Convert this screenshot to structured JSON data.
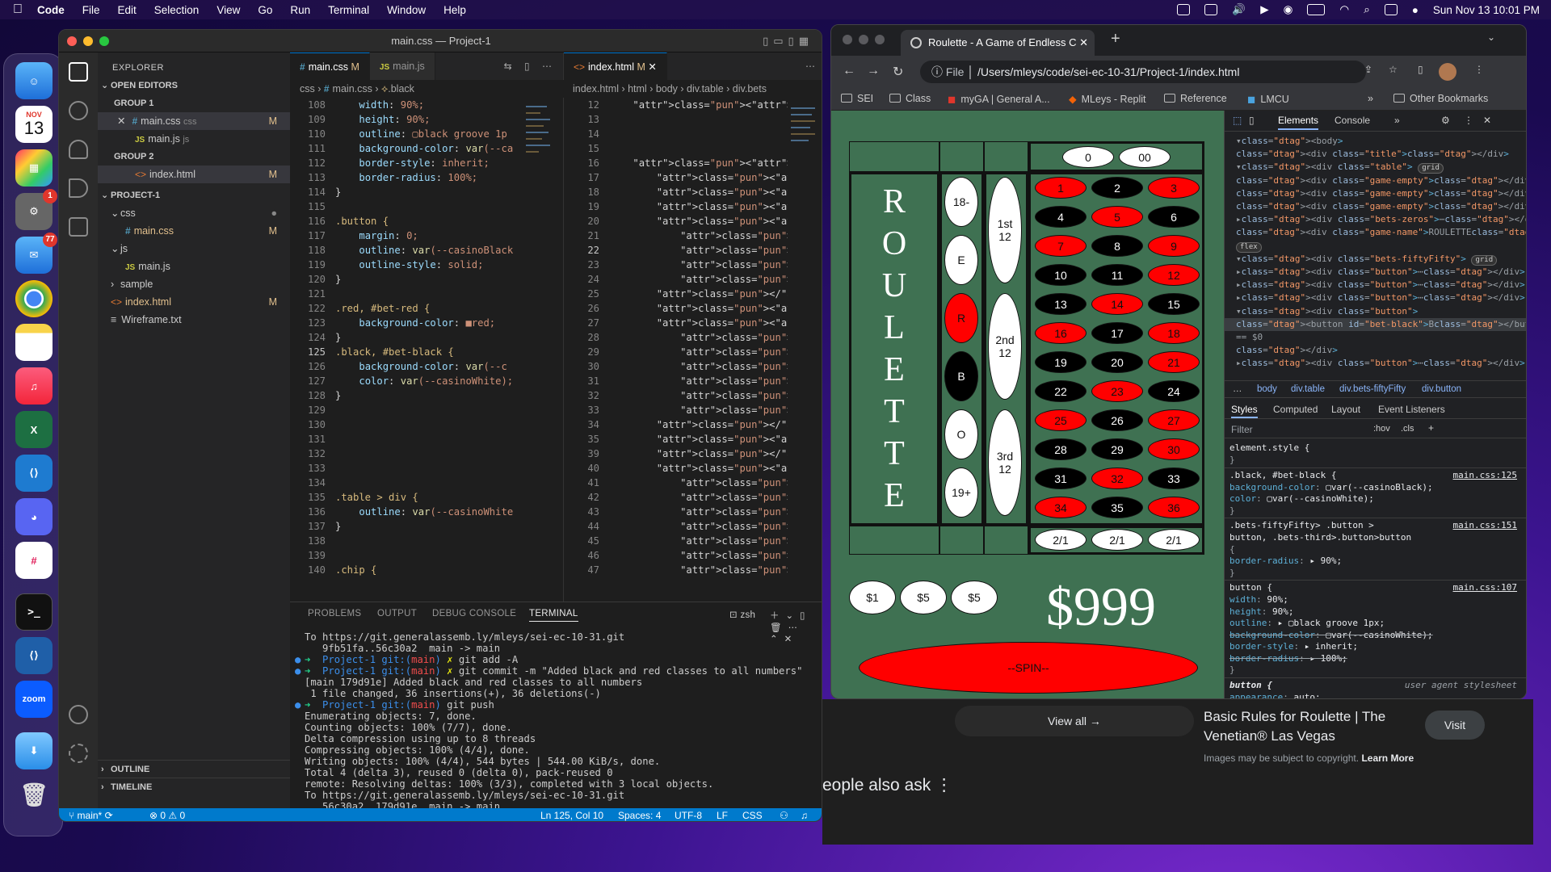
{
  "menubar": {
    "app": "Code",
    "items": [
      "File",
      "Edit",
      "Selection",
      "View",
      "Go",
      "Run",
      "Terminal",
      "Window",
      "Help"
    ],
    "datetime": "Sun Nov 13  10:01 PM"
  },
  "dock": {
    "calendar_month": "NOV",
    "calendar_day": "13",
    "settings_badge": "1",
    "mail_badge": "77",
    "zoom_label": "zoom"
  },
  "vscode": {
    "title": "main.css — Project-1",
    "explorer": {
      "header": "EXPLORER",
      "open_editors": "OPEN EDITORS",
      "group1": "GROUP 1",
      "group2": "GROUP 2",
      "project": "PROJECT-1",
      "g1_items": [
        {
          "name": "main.css",
          "path": "css",
          "mod": "M"
        },
        {
          "name": "main.js",
          "path": "js",
          "mod": ""
        }
      ],
      "g2_items": [
        {
          "name": "index.html",
          "path": "",
          "mod": "M"
        }
      ],
      "tree": [
        {
          "name": "css",
          "type": "folder",
          "mod": "●"
        },
        {
          "name": "main.css",
          "type": "css",
          "mod": "M"
        },
        {
          "name": "js",
          "type": "folder",
          "mod": ""
        },
        {
          "name": "main.js",
          "type": "js",
          "mod": ""
        },
        {
          "name": "sample",
          "type": "folder-closed",
          "mod": ""
        },
        {
          "name": "index.html",
          "type": "html",
          "mod": "M"
        },
        {
          "name": "Wireframe.txt",
          "type": "txt",
          "mod": ""
        }
      ],
      "outline": "OUTLINE",
      "timeline": "TIMELINE"
    },
    "left_tabs": [
      {
        "label": "main.css",
        "mod": "M"
      },
      {
        "label": "main.js",
        "mod": ""
      }
    ],
    "left_breadcrumb": [
      "css",
      "main.css",
      ".black"
    ],
    "right_tabs": [
      {
        "label": "index.html",
        "mod": "M"
      }
    ],
    "right_breadcrumb": [
      "index.html",
      "html",
      "body",
      "div.table",
      "div.bets"
    ],
    "css_lines": [
      {
        "n": "108",
        "t": "    width: 90%;"
      },
      {
        "n": "109",
        "t": "    height: 90%;"
      },
      {
        "n": "110",
        "t": "    outline: ▢black groove 1p"
      },
      {
        "n": "111",
        "t": "    background-color: var(--ca"
      },
      {
        "n": "112",
        "t": "    border-style: inherit;"
      },
      {
        "n": "113",
        "t": "    border-radius: 100%;"
      },
      {
        "n": "114",
        "t": "}"
      },
      {
        "n": "115",
        "t": ""
      },
      {
        "n": "116",
        "t": ".button {"
      },
      {
        "n": "117",
        "t": "    margin: 0;"
      },
      {
        "n": "118",
        "t": "    outline: var(--casinoBlack"
      },
      {
        "n": "119",
        "t": "    outline-style: solid;"
      },
      {
        "n": "120",
        "t": "}"
      },
      {
        "n": "121",
        "t": ""
      },
      {
        "n": "122",
        "t": ".red, #bet-red {"
      },
      {
        "n": "123",
        "t": "    background-color: ■red;"
      },
      {
        "n": "124",
        "t": "}"
      },
      {
        "n": "125",
        "t": ".black, #bet-black {"
      },
      {
        "n": "126",
        "t": "    background-color: var(--c"
      },
      {
        "n": "127",
        "t": "    color: var(--casinoWhite);"
      },
      {
        "n": "128",
        "t": "}"
      },
      {
        "n": "129",
        "t": ""
      },
      {
        "n": "130",
        "t": ""
      },
      {
        "n": "131",
        "t": ""
      },
      {
        "n": "132",
        "t": ""
      },
      {
        "n": "133",
        "t": ""
      },
      {
        "n": "134",
        "t": ""
      },
      {
        "n": "135",
        "t": ".table > div {"
      },
      {
        "n": "136",
        "t": "    outline: var(--casinoWhite"
      },
      {
        "n": "137",
        "t": "}"
      },
      {
        "n": "138",
        "t": ""
      },
      {
        "n": "139",
        "t": ""
      },
      {
        "n": "140",
        "t": ".chip {"
      }
    ],
    "html_lines": [
      {
        "n": "12",
        "t": "    <div class=\"title\"></div>"
      },
      {
        "n": "13",
        "t": ""
      },
      {
        "n": "14",
        "t": ""
      },
      {
        "n": "15",
        "t": ""
      },
      {
        "n": "16",
        "t": "    <div class=\"table\">"
      },
      {
        "n": "17",
        "t": "        <div class=\"game-empty\"></div"
      },
      {
        "n": "18",
        "t": "        <div class=\"game-empty\"></div"
      },
      {
        "n": "19",
        "t": "        <div class=\"game-empty\"></div"
      },
      {
        "n": "20",
        "t": "        <div class=\"bets-zeros\">"
      },
      {
        "n": "21",
        "t": "            <div>"
      },
      {
        "n": "22",
        "t": "            <div class=\"button\"><butt"
      },
      {
        "n": "23",
        "t": "            <div class=\"button\"><butt"
      },
      {
        "n": "24",
        "t": "            </div></div>"
      },
      {
        "n": "25",
        "t": "        </div>"
      },
      {
        "n": "26",
        "t": "        <div class=\"game-name\">ROULETT"
      },
      {
        "n": "27",
        "t": "        <div class=\"bets-fiftyFifty\">"
      },
      {
        "n": "28",
        "t": "            <div class=\"button\"><butt"
      },
      {
        "n": "29",
        "t": "            <div class=\"button\"><butt"
      },
      {
        "n": "30",
        "t": "            <div class=\"button\"><butt"
      },
      {
        "n": "31",
        "t": "            <div class=\"button\"><butt"
      },
      {
        "n": "32",
        "t": "            <div class=\"button\"><butt"
      },
      {
        "n": "33",
        "t": "            <div class=\"button\"><butt"
      },
      {
        "n": "34",
        "t": "        </div>"
      },
      {
        "n": "35",
        "t": "        <div class=\"bets-third\">⋯"
      },
      {
        "n": "39",
        "t": "        </div>"
      },
      {
        "n": "40",
        "t": "        <div class=\"bets-number\">"
      },
      {
        "n": "41",
        "t": "            <div class=\"button\"><butt"
      },
      {
        "n": "42",
        "t": "            <div class=\"button\"><butt"
      },
      {
        "n": "43",
        "t": "            <div class=\"button\"><butt"
      },
      {
        "n": "44",
        "t": "            <div class=\"button\"><butt"
      },
      {
        "n": "45",
        "t": "            <div class=\"button\"><butt"
      },
      {
        "n": "46",
        "t": "            <div class=\"button\"><butt"
      },
      {
        "n": "47",
        "t": "            <div class=\"button\"><butt"
      }
    ],
    "panel_tabs": [
      "PROBLEMS",
      "OUTPUT",
      "DEBUG CONSOLE",
      "TERMINAL"
    ],
    "shell": "zsh",
    "terminal": [
      "To https://git.generalassemb.ly/mleys/sei-ec-10-31.git",
      "   9fb51fa..56c30a2  main -> main",
      "➜  Project-1 git:(main) ✗ git add -A",
      "➜  Project-1 git:(main) ✗ git commit -m \"Added black and red classes to all numbers\"",
      "[main 179d91e] Added black and red classes to all numbers",
      " 1 file changed, 36 insertions(+), 36 deletions(-)",
      "➜  Project-1 git:(main) git push",
      "Enumerating objects: 7, done.",
      "Counting objects: 100% (7/7), done.",
      "Delta compression using up to 8 threads",
      "Compressing objects: 100% (4/4), done.",
      "Writing objects: 100% (4/4), 544 bytes | 544.00 KiB/s, done.",
      "Total 4 (delta 3), reused 0 (delta 0), pack-reused 0",
      "remote: Resolving deltas: 100% (3/3), completed with 3 local objects.",
      "To https://git.generalassemb.ly/mleys/sei-ec-10-31.git",
      "   56c30a2..179d91e  main -> main",
      "➜  Project-1 git:(main) ✗ "
    ],
    "status": {
      "branch": "main*",
      "errors": "0",
      "warnings": "0",
      "position": "Ln 125, Col 10",
      "spaces": "Spaces: 4",
      "encoding": "UTF-8",
      "eol": "LF",
      "lang": "CSS"
    }
  },
  "chrome": {
    "tab_title": "Roulette - A Game of Endless C",
    "url_scheme": "File",
    "url": "/Users/mleys/code/sei-ec-10-31/Project-1/index.html",
    "bookmarks": [
      "SEI",
      "Class",
      "myGA | General A...",
      "MLeys - Replit",
      "Reference",
      "LMCU"
    ],
    "other_bookmarks": "Other Bookmarks",
    "page": {
      "zeros": [
        "0",
        "00"
      ],
      "title_letters": [
        "R",
        "O",
        "U",
        "L",
        "E",
        "T",
        "T",
        "E"
      ],
      "fifty": [
        "18-",
        "E",
        "R",
        "B",
        "O",
        "19+"
      ],
      "thirds": [
        "1st\n12",
        "2nd\n12",
        "3rd\n12"
      ],
      "numbers": [
        [
          "1",
          "2",
          "3"
        ],
        [
          "4",
          "5",
          "6"
        ],
        [
          "7",
          "8",
          "9"
        ],
        [
          "10",
          "11",
          "12"
        ],
        [
          "13",
          "14",
          "15"
        ],
        [
          "16",
          "17",
          "18"
        ],
        [
          "19",
          "20",
          "21"
        ],
        [
          "22",
          "23",
          "24"
        ],
        [
          "25",
          "26",
          "27"
        ],
        [
          "28",
          "29",
          "30"
        ],
        [
          "31",
          "32",
          "33"
        ],
        [
          "34",
          "35",
          "36"
        ]
      ],
      "reds": [
        "1",
        "3",
        "5",
        "7",
        "9",
        "12",
        "14",
        "16",
        "18",
        "21",
        "23",
        "25",
        "27",
        "30",
        "32",
        "34",
        "36"
      ],
      "columns": [
        "2/1",
        "2/1",
        "2/1"
      ],
      "chips": [
        "$1",
        "$5",
        "$5"
      ],
      "bank": "$999",
      "spin": "--SPIN--"
    },
    "devtools": {
      "tabs": [
        "Elements",
        "Console"
      ],
      "dom": [
        "▾<body>",
        "  <div class=\"title\"></div>",
        "  ▾<div class=\"table\"> grid",
        "      <div class=\"game-empty\"></div>",
        "      <div class=\"game-empty\"></div>",
        "      <div class=\"game-empty\"></div>",
        "    ▸<div class=\"bets-zeros\">⋯</div> grid",
        "      <div class=\"game-name\">ROULETTE</div>",
        "       flex",
        "    ▾<div class=\"bets-fiftyFifty\"> grid",
        "      ▸<div class=\"button\">⋯</div>",
        "      ▸<div class=\"button\">⋯</div>",
        "      ▸<div class=\"button\">⋯</div>",
        "      ▾<div class=\"button\">",
        "          <button id=\"bet-black\">B</button>",
        "           == $0",
        "        </div>",
        "      ▸<div class=\"button\">⋯</div>"
      ],
      "crumbs": [
        "body",
        "div.table",
        "div.bets-fiftyFifty",
        "div.button"
      ],
      "style_tabs": [
        "Styles",
        "Computed",
        "Layout",
        "Event Listeners"
      ],
      "filter_placeholder": "Filter",
      "hov": ":hov",
      "cls": ".cls",
      "rules": [
        {
          "sel": "element.style {",
          "src": "",
          "lines": [
            "}"
          ]
        },
        {
          "sel": ".black, #bet-black {",
          "src": "main.css:125",
          "lines": [
            "  background-color: ▢var(--casinoBlack);",
            "  color: ▢var(--casinoWhite);",
            "}"
          ]
        },
        {
          "sel": ".bets-fiftyFifty> .button >",
          "src": "main.css:151",
          "lines": [
            "button, .bets-third>.button>button",
            "{",
            "  border-radius: ▸ 90%;",
            "}"
          ]
        },
        {
          "sel": "button {",
          "src": "main.css:107",
          "lines": [
            "  width: 90%;",
            "  height: 90%;",
            "  outline: ▸ ▢black groove 1px;",
            "  background-color: ▢var(--casinoWhite);",
            "  border-style: ▸ inherit;",
            "  border-radius: ▸ 100%;",
            "}"
          ]
        },
        {
          "sel": "button {",
          "src": "user agent stylesheet",
          "lines": [
            "  appearance: auto;"
          ]
        }
      ]
    }
  },
  "google": {
    "view_all": "View all",
    "result_title": "Basic Rules for Roulette | The Venetian® Las Vegas",
    "visit": "Visit",
    "note": "Images may be subject to copyright.",
    "learn_more": "Learn More",
    "people_also_ask": "eople also ask"
  },
  "colors": {
    "vscode_accent": "#007acc",
    "table_green": "#3f7152",
    "red": "#ff0000",
    "black": "#000000"
  }
}
